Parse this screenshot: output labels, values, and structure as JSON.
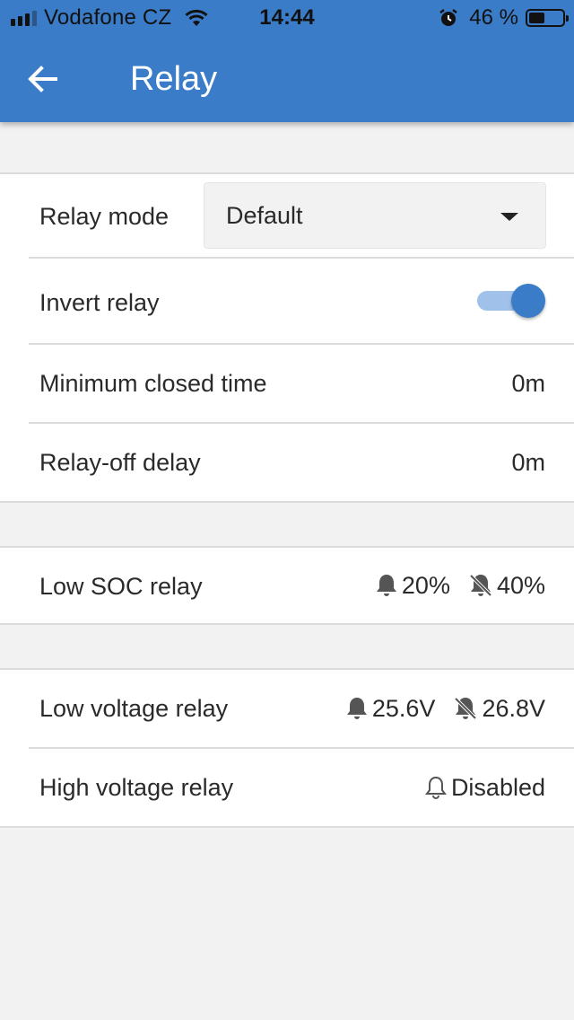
{
  "status_bar": {
    "carrier": "Vodafone CZ",
    "time": "14:44",
    "battery_percent": "46 %",
    "battery_level": 0.46,
    "icons": [
      "signal-icon",
      "wifi-icon",
      "alarm-clock-icon",
      "battery-icon"
    ]
  },
  "header": {
    "title": "Relay",
    "back_icon": "arrow-left-icon"
  },
  "colors": {
    "accent": "#3a7cc7",
    "background": "#f2f2f2"
  },
  "relay_settings": {
    "relay_mode": {
      "label": "Relay mode",
      "value": "Default"
    },
    "invert_relay": {
      "label": "Invert relay",
      "enabled": true
    },
    "minimum_closed_time": {
      "label": "Minimum closed time",
      "value": "0m"
    },
    "relay_off_delay": {
      "label": "Relay-off delay",
      "value": "0m"
    }
  },
  "soc": {
    "low_soc_relay": {
      "label": "Low SOC relay",
      "set": "20%",
      "clear": "40%"
    }
  },
  "voltage": {
    "low_voltage_relay": {
      "label": "Low voltage relay",
      "set": "25.6V",
      "clear": "26.8V"
    },
    "high_voltage_relay": {
      "label": "High voltage relay",
      "value": "Disabled"
    }
  }
}
